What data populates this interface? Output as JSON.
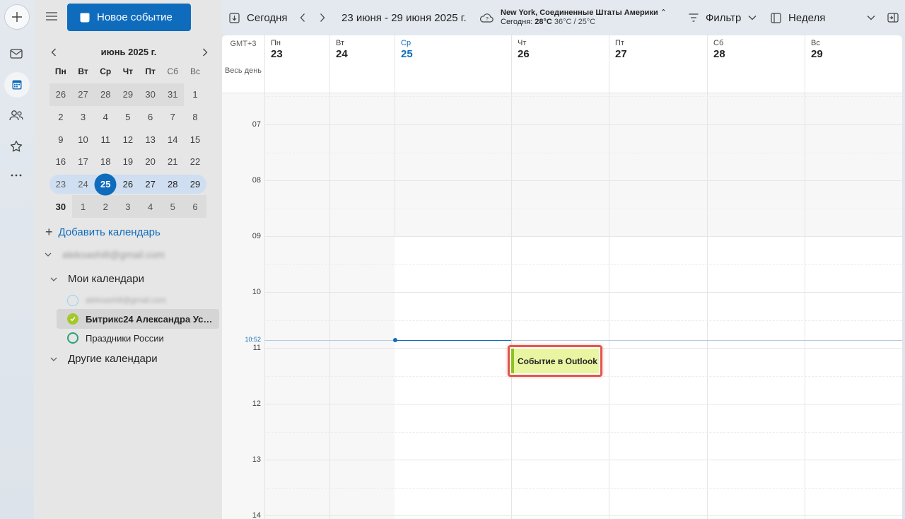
{
  "app": {
    "new_event_label": "Новое событие",
    "rail": [
      {
        "name": "mail-icon"
      },
      {
        "name": "calendar-icon"
      },
      {
        "name": "people-icon"
      },
      {
        "name": "star-icon"
      },
      {
        "name": "more-icon"
      }
    ]
  },
  "mini_calendar": {
    "title": "июнь 2025 г.",
    "weekdays": [
      "Пн",
      "Вт",
      "Ср",
      "Чт",
      "Пт",
      "Сб",
      "Вс"
    ],
    "weeks": [
      [
        "26",
        "27",
        "28",
        "29",
        "30",
        "31",
        "1"
      ],
      [
        "2",
        "3",
        "4",
        "5",
        "6",
        "7",
        "8"
      ],
      [
        "9",
        "10",
        "11",
        "12",
        "13",
        "14",
        "15"
      ],
      [
        "16",
        "17",
        "18",
        "19",
        "20",
        "21",
        "22"
      ],
      [
        "23",
        "24",
        "25",
        "26",
        "27",
        "28",
        "29"
      ],
      [
        "30",
        "1",
        "2",
        "3",
        "4",
        "5",
        "6"
      ]
    ],
    "selected_week_index": 4,
    "today": "25"
  },
  "sidebar": {
    "add_calendar_label": "Добавить календарь",
    "account_email": "alekoashi8@gmail.com",
    "my_calendars_label": "Мои календари",
    "other_calendars_label": "Другие календари",
    "calendars": [
      {
        "label": "alekoashi8@gmail.com",
        "color": "#8fd3f0",
        "checked": false
      },
      {
        "label": "Битрикс24 Александра Усын...",
        "color": "#a4c82c",
        "checked": true
      },
      {
        "label": "Праздники России",
        "color": "#2aa275",
        "checked": false
      }
    ]
  },
  "toolbar": {
    "today_label": "Сегодня",
    "date_range": "23 июня - 29 июня 2025 г.",
    "weather_location": "New York, Соединенные Штаты Америки",
    "weather_today_prefix": "Сегодня:",
    "weather_current": "28°C",
    "weather_range": "36°C / 25°C",
    "filter_label": "Фильтр",
    "view_label": "Неделя"
  },
  "week_view": {
    "timezone": "GMT+3",
    "all_day_label": "Весь день",
    "days": [
      {
        "dow": "Пн",
        "num": "23"
      },
      {
        "dow": "Вт",
        "num": "24"
      },
      {
        "dow": "Ср",
        "num": "25",
        "today": true
      },
      {
        "dow": "Чт",
        "num": "26"
      },
      {
        "dow": "Пт",
        "num": "27"
      },
      {
        "dow": "Сб",
        "num": "28"
      },
      {
        "dow": "Вс",
        "num": "29"
      }
    ],
    "hours": [
      "07",
      "08",
      "09",
      "10",
      "11",
      "12",
      "13",
      "14"
    ],
    "current_time": "10:52",
    "events": [
      {
        "title": "Событие в Outlook",
        "day": "Чт",
        "start": "11:00",
        "end": "11:30",
        "color": "#e9f5a1",
        "accent": "#8cc224"
      }
    ]
  },
  "colors": {
    "accent": "#0f6cbd",
    "event_highlight": "#e2574c"
  }
}
